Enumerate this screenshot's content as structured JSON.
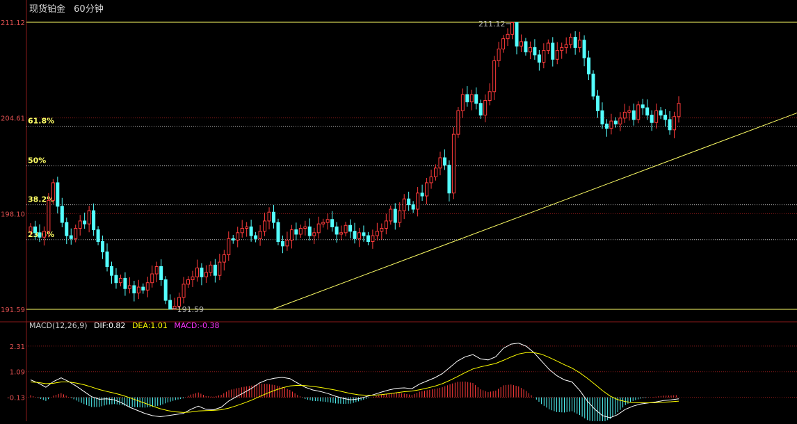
{
  "header": {
    "instrument": "现货铂金",
    "period": "60分钟"
  },
  "colors": {
    "up": "#ff3b3b",
    "down": "#54ffff",
    "dif": "#ffffff",
    "dea": "#ffff00",
    "macd_label": "#ff33ff",
    "grid": "#8b1a1a",
    "axis_text": "#e05050",
    "fib": "#ffff66",
    "line": "#ffff66"
  },
  "macd_legend": {
    "name": "MACD(12,26,9)",
    "dif": "DIF:0.82",
    "dea": "DEA:1.01",
    "macd": "MACD:-0.38"
  },
  "chart_data": [
    {
      "type": "candlestick",
      "title": "现货铂金 60分钟",
      "ylim": [
        191.59,
        211.12
      ],
      "y_ticks": [
        "211.12",
        "204.61",
        "198.10",
        "191.59"
      ],
      "annotations": {
        "high": "211.12",
        "low": "191.59"
      },
      "fibonacci": [
        {
          "label": "61.8%",
          "value": 204.05
        },
        {
          "label": "50%",
          "value": 201.35
        },
        {
          "label": "38.2%",
          "value": 198.7
        },
        {
          "label": "23.6%",
          "value": 196.33
        }
      ],
      "trendline": {
        "from_index": 55,
        "to_value_at_end": 204.95,
        "start_value": 191.59
      },
      "close": [
        197.2,
        196.8,
        196.5,
        196.9,
        199.0,
        200.2,
        198.6,
        197.5,
        196.6,
        196.4,
        197.1,
        197.6,
        197.4,
        198.3,
        197.0,
        196.2,
        195.5,
        194.5,
        193.9,
        193.4,
        193.7,
        193.0,
        193.2,
        192.7,
        193.1,
        192.9,
        193.4,
        194.0,
        194.5,
        193.6,
        192.2,
        191.6,
        191.8,
        192.4,
        193.3,
        193.6,
        193.8,
        194.4,
        193.8,
        194.1,
        194.6,
        193.9,
        194.8,
        195.3,
        196.4,
        196.3,
        196.8,
        197.1,
        197.2,
        196.6,
        196.4,
        196.9,
        197.6,
        198.2,
        197.5,
        196.2,
        195.9,
        196.3,
        197.0,
        196.7,
        197.1,
        197.2,
        196.6,
        196.8,
        197.4,
        197.5,
        197.7,
        197.2,
        196.7,
        196.8,
        197.3,
        196.9,
        196.4,
        196.8,
        196.6,
        196.2,
        196.6,
        196.9,
        197.1,
        197.6,
        198.4,
        197.5,
        198.3,
        199.1,
        198.7,
        198.4,
        199.5,
        199.3,
        200.2,
        200.6,
        201.2,
        201.9,
        201.4,
        199.5,
        203.5,
        205.1,
        206.2,
        205.7,
        206.2,
        205.6,
        204.8,
        205.8,
        206.4,
        208.5,
        209.3,
        210.0,
        210.3,
        211.1,
        209.5,
        209.8,
        209.1,
        209.4,
        208.9,
        208.4,
        209.2,
        209.7,
        208.6,
        209.2,
        209.4,
        209.6,
        210.1,
        209.4,
        209.9,
        208.7,
        207.6,
        206.1,
        205.1,
        204.2,
        203.9,
        204.4,
        204.2,
        204.6,
        205.0,
        205.1,
        204.5,
        205.5,
        205.3,
        204.8,
        204.3,
        205.1,
        204.8,
        204.5,
        203.8,
        204.7,
        205.6
      ],
      "ohlc_derivation": "close series; open = previous close"
    },
    {
      "type": "macd",
      "title": "MACD(12,26,9)",
      "ylim": [
        -1.2,
        2.8
      ],
      "y_ticks": [
        "2.31",
        "1.09",
        "-0.13"
      ],
      "series": [
        {
          "name": "DIF",
          "values": [
            0.7,
            0.55,
            0.35,
            0.62,
            0.8,
            0.62,
            0.4,
            0.15,
            -0.1,
            -0.22,
            -0.2,
            -0.25,
            -0.4,
            -0.6,
            -0.75,
            -0.9,
            -1.0,
            -1.05,
            -1.0,
            -0.95,
            -0.9,
            -0.7,
            -0.55,
            -0.7,
            -0.72,
            -0.6,
            -0.3,
            -0.1,
            0.1,
            0.3,
            0.55,
            0.7,
            0.78,
            0.82,
            0.76,
            0.55,
            0.35,
            0.22,
            0.15,
            0.05,
            -0.08,
            -0.18,
            -0.25,
            -0.2,
            -0.1,
            0.0,
            0.12,
            0.22,
            0.3,
            0.32,
            0.28,
            0.5,
            0.65,
            0.8,
            1.0,
            1.3,
            1.6,
            1.8,
            1.9,
            1.7,
            1.65,
            1.8,
            2.2,
            2.4,
            2.45,
            2.3,
            2.0,
            1.6,
            1.2,
            0.9,
            0.7,
            0.6,
            0.2,
            -0.3,
            -0.7,
            -1.0,
            -1.1,
            -0.95,
            -0.7,
            -0.55,
            -0.45,
            -0.4,
            -0.35,
            -0.28,
            -0.25,
            -0.2
          ]
        },
        {
          "name": "DEA",
          "values": [
            0.6,
            0.58,
            0.52,
            0.54,
            0.6,
            0.6,
            0.55,
            0.47,
            0.36,
            0.24,
            0.15,
            0.07,
            -0.03,
            -0.15,
            -0.28,
            -0.41,
            -0.55,
            -0.67,
            -0.76,
            -0.82,
            -0.85,
            -0.83,
            -0.78,
            -0.76,
            -0.75,
            -0.72,
            -0.64,
            -0.53,
            -0.4,
            -0.26,
            -0.1,
            0.06,
            0.2,
            0.32,
            0.41,
            0.44,
            0.43,
            0.39,
            0.34,
            0.28,
            0.21,
            0.13,
            0.05,
            -0.01,
            -0.03,
            -0.03,
            0.0,
            0.04,
            0.09,
            0.14,
            0.17,
            0.23,
            0.31,
            0.4,
            0.52,
            0.68,
            0.86,
            1.05,
            1.22,
            1.32,
            1.4,
            1.48,
            1.63,
            1.79,
            1.93,
            2.0,
            2.0,
            1.92,
            1.77,
            1.6,
            1.42,
            1.26,
            1.04,
            0.78,
            0.49,
            0.19,
            -0.07,
            -0.24,
            -0.33,
            -0.38,
            -0.39,
            -0.39,
            -0.38,
            -0.36,
            -0.34,
            -0.31
          ]
        },
        {
          "name": "MACD",
          "values": [
            0.2,
            -0.06,
            -0.34,
            0.16,
            0.4,
            0.04,
            -0.3,
            -0.64,
            -0.92,
            -0.92,
            -0.7,
            -0.64,
            -0.74,
            -0.9,
            -0.94,
            -0.98,
            -0.9,
            -0.76,
            -0.48,
            -0.26,
            -0.1,
            0.26,
            0.46,
            0.12,
            0.06,
            0.24,
            0.68,
            0.86,
            1.0,
            1.12,
            1.3,
            1.28,
            1.16,
            1.0,
            0.7,
            0.22,
            -0.16,
            -0.34,
            -0.38,
            -0.46,
            -0.58,
            -0.62,
            -0.6,
            -0.38,
            -0.14,
            0.06,
            0.24,
            0.36,
            0.42,
            0.36,
            0.22,
            0.54,
            0.68,
            0.8,
            0.96,
            1.24,
            1.48,
            1.5,
            1.36,
            0.76,
            0.5,
            0.64,
            1.14,
            1.22,
            1.04,
            0.6,
            0.0,
            -0.64,
            -1.14,
            -1.4,
            -1.44,
            -1.32,
            -1.68,
            -2.16,
            -2.38,
            -2.38,
            -2.06,
            -1.42,
            -0.74,
            -0.34,
            -0.12,
            -0.02,
            0.06,
            0.16,
            0.18,
            0.22
          ]
        }
      ]
    }
  ]
}
